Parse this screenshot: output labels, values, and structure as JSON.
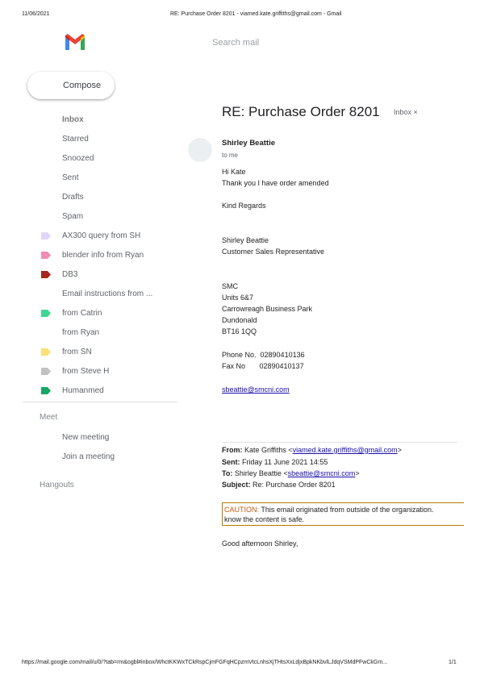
{
  "print_header": {
    "date": "11/06/2021",
    "title": "RE: Purchase Order 8201 - viamed.kate.griffiths@gmail.com - Gmail"
  },
  "search": {
    "placeholder": "Search mail"
  },
  "compose": {
    "label": "Compose"
  },
  "sidebar": {
    "items": [
      {
        "label": "Inbox"
      },
      {
        "label": "Starred"
      },
      {
        "label": "Snoozed"
      },
      {
        "label": "Sent"
      },
      {
        "label": "Drafts"
      },
      {
        "label": "Spam"
      },
      {
        "label": "AX300 query from SH",
        "color": "#e1d5f7"
      },
      {
        "label": "blender info from Ryan",
        "color": "#f28bb1"
      },
      {
        "label": "DB3",
        "color": "#a8261d"
      },
      {
        "label": "Email instructions from ..."
      },
      {
        "label": "from Catrin",
        "color": "#42d692"
      },
      {
        "label": "from Ryan"
      },
      {
        "label": "from SN",
        "color": "#fde07a"
      },
      {
        "label": "from Steve H",
        "color": "#c2c2c2"
      },
      {
        "label": "Humanmed",
        "color": "#16a765"
      }
    ],
    "meet": {
      "heading": "Meet",
      "items": [
        "New meeting",
        "Join a meeting"
      ]
    },
    "hangouts": {
      "heading": "Hangouts"
    }
  },
  "email": {
    "subject": "RE: Purchase Order 8201",
    "label_chip": "Inbox ×",
    "sender": "Shirley Beattie",
    "to_line": "to me",
    "greeting": "Hi Kate",
    "line1": "Thank you I have order amended",
    "regards": "Kind Regards",
    "sig_name": "Shirley Beattie",
    "sig_title": "Customer Sales Representative",
    "company": "SMC",
    "addr1": "Units 6&7",
    "addr2": "Carrowreagh Business Park",
    "addr3": "Dundonald",
    "addr4": "BT16 1QQ",
    "phone": "Phone No.  02890410136",
    "fax": "Fax No       02890410137",
    "email_link": "sbeattie@smcni.com"
  },
  "quoted": {
    "from_label": "From:",
    "from_name": "Kate Griffiths <",
    "from_email": "viamed.kate.griffiths@gmail.com",
    "from_end": ">",
    "sent_label": "Sent:",
    "sent_value": "Friday 11 June 2021 14:55",
    "to_label": "To:",
    "to_name": "Shirley Beattie <",
    "to_email": "sbeattie@smcni.com",
    "to_end": ">",
    "subject_label": "Subject:",
    "subject_value": "Re: Purchase Order 8201",
    "caution_word": "CAUTION:",
    "caution_text": " This email originated from outside of the organization.",
    "caution_text2": "know the content is safe.",
    "greeting": "Good afternoon Shirley,"
  },
  "print_footer": {
    "url": "https://mail.google.com/mail/u/0/?tab=rm&ogbl#inbox/WhctKKWxTCkRspCjmFGFqHCpzmVtcLnhsXjTHtsXxLdjxBpkNKbvlLJdqVSMdPFwCkGm...",
    "page": "1/1"
  }
}
